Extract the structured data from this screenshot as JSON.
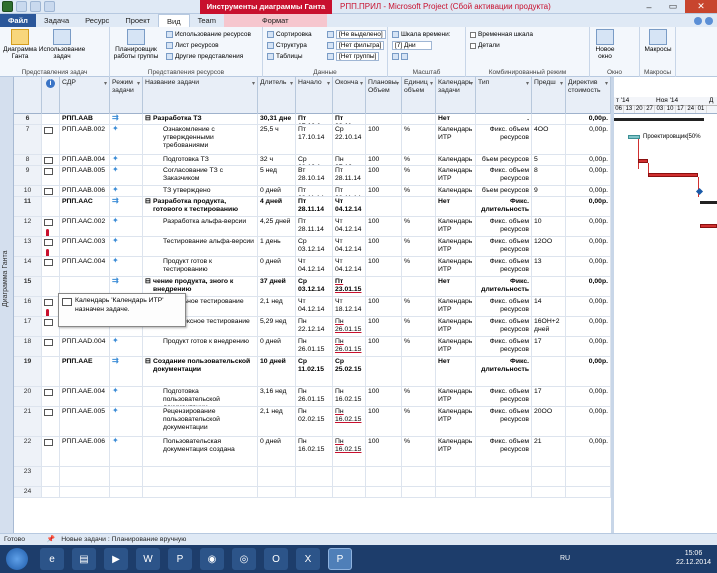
{
  "titlebar": {
    "tools": "Инструменты диаграммы Ганта",
    "file": "РПП.ПРИЛ",
    "sep": "-",
    "app": "Microsoft Project (Сбой активации продукта)"
  },
  "tabs": [
    "Файл",
    "Задача",
    "Ресурс",
    "Проект",
    "Вид",
    "Team",
    "Формат"
  ],
  "ribbon": {
    "gantt_btn": "Диаграмма Ганта",
    "usage_btn": "Использование задач",
    "planner_btn": "Планировщик работы группы",
    "res_usage": "Использование ресурсов",
    "res_sheet": "Лист ресурсов",
    "other_views": "Другие представления",
    "sort": "Сортировка",
    "structure": "Структура",
    "tables": "Таблицы",
    "hl_val": "[Не выделено]",
    "filter_val": "[Нет фильтра]",
    "group_val": "[Нет группы]",
    "timescale": "Шкала времени:",
    "timescale_val": "[7] Дни",
    "timeline_chk": "Временная шкала",
    "details_chk": "Детали",
    "new_window": "Новое окно",
    "macros": "Макросы",
    "g_task_views": "Представления задач",
    "g_res_views": "Представления ресурсов",
    "g_data": "Данные",
    "g_zoom": "Масштаб",
    "g_split": "Комбинированный режим",
    "g_window": "Окно",
    "g_macros": "Макросы"
  },
  "sidebar_label": "Диаграмма Ганта",
  "columns": [
    "СДР",
    "Режим задачи",
    "Название задачи",
    "Длитель",
    "Начало",
    "Оконча",
    "Плановы Объем",
    "Единиц объем",
    "Календарь задачи",
    "Тип",
    "Предш",
    "Директив стоимость"
  ],
  "rows": [
    {
      "n": "6",
      "icons": "",
      "mode": "auto",
      "wbs": "РПП.ААВ",
      "name": "Разработка ТЗ",
      "dur": "30,31 дне",
      "start": "Пт 17.10.1",
      "end": "Пт 28.11.",
      "plan": "",
      "unit": "",
      "cal": "Нет",
      "type": ". длительность",
      "pred": "",
      "cost": "0,00р.",
      "sum": true,
      "indent": 0
    },
    {
      "n": "7",
      "icons": "grid",
      "mode": "pin",
      "wbs": "РПП.ААВ.002",
      "name": "Ознакомление с утвержденными требованиями",
      "dur": "25,5 ч",
      "start": "Пт 17.10.14",
      "end": "Ср 22.10.14",
      "plan": "100",
      "unit": "%",
      "cal": "Календарь ИТР",
      "type": "Фикс. объем ресурсов",
      "pred": "4OO",
      "cost": "0,00р.",
      "sum": false,
      "indent": 1
    },
    {
      "n": "8",
      "icons": "grid",
      "mode": "pin",
      "wbs": "РПП.ААВ.004",
      "name": "Подготовка ТЗ",
      "dur": "32 ч",
      "start": "Ср 22.10.1",
      "end": "Пн 27.10.",
      "plan": "100",
      "unit": "%",
      "cal": "Календарь",
      "type": "бъем ресурсов",
      "pred": "5",
      "cost": "0,00р.",
      "sum": false,
      "indent": 1
    },
    {
      "n": "9",
      "icons": "grid",
      "mode": "pin",
      "wbs": "РПП.ААВ.005",
      "name": "Согласование ТЗ с Заказчиком",
      "dur": "5 нед",
      "start": "Вт 28.10.14",
      "end": "Пт 28.11.14",
      "plan": "100",
      "unit": "%",
      "cal": "Календарь ИТР",
      "type": "Фикс. объем ресурсов",
      "pred": "8",
      "cost": "0,00р.",
      "sum": false,
      "indent": 1
    },
    {
      "n": "10",
      "icons": "grid",
      "mode": "pin",
      "wbs": "РПП.ААВ.006",
      "name": "ТЗ утверждено",
      "dur": "0 дней",
      "start": "Пт 28.11.14",
      "end": "Пт 28.11.14",
      "plan": "100",
      "unit": "%",
      "cal": "Календарь",
      "type": "бъем ресурсов",
      "pred": "9",
      "cost": "0,00р.",
      "sum": false,
      "indent": 1
    },
    {
      "n": "11",
      "icons": "",
      "mode": "auto",
      "wbs": "РПП.ААС",
      "name": "Разработка продукта, готового к тестированию",
      "dur": "4 дней",
      "start": "Пт 28.11.14",
      "end": "Чт 04.12.14",
      "plan": "",
      "unit": "",
      "cal": "Нет",
      "type": "Фикс. длительность",
      "pred": "",
      "cost": "0,00р.",
      "sum": true,
      "indent": 0
    },
    {
      "n": "12",
      "icons": "gridp",
      "mode": "pin",
      "wbs": "РПП.ААС.002",
      "name": "Разработка альфа-версии",
      "dur": "4,25 дней",
      "start": "Пт 28.11.14",
      "end": "Чт 04.12.14",
      "plan": "100",
      "unit": "%",
      "cal": "Календарь ИТР",
      "type": "Фикс. объем ресурсов",
      "pred": "10",
      "cost": "0,00р.",
      "sum": false,
      "indent": 1
    },
    {
      "n": "13",
      "icons": "gridp",
      "mode": "pin",
      "wbs": "РПП.ААС.003",
      "name": "Тестирование альфа-версии",
      "dur": "1 день",
      "start": "Ср 03.12.14",
      "end": "Чт 04.12.14",
      "plan": "100",
      "unit": "%",
      "cal": "Календарь ИТР",
      "type": "Фикс. объем ресурсов",
      "pred": "12OO",
      "cost": "0,00р.",
      "sum": false,
      "indent": 1
    },
    {
      "n": "14",
      "icons": "grid",
      "mode": "pin",
      "wbs": "РПП.ААС.004",
      "name": "Продукт готов к тестированию",
      "dur": "0 дней",
      "start": "Чт 04.12.14",
      "end": "Чт 04.12.14",
      "plan": "100",
      "unit": "%",
      "cal": "Календарь ИТР",
      "type": "Фикс. объем ресурсов",
      "pred": "13",
      "cost": "0,00р.",
      "sum": false,
      "indent": 1
    },
    {
      "n": "15",
      "icons": "",
      "mode": "auto",
      "wbs": "",
      "name": "чение продукта, зного к внедрению",
      "dur": "37 дней",
      "start": "Ср 03.12.14",
      "end": "Пт 23.01.15",
      "plan": "",
      "unit": "",
      "cal": "Нет",
      "type": "Фикс. длительность",
      "pred": "",
      "cost": "0,00р.",
      "sum": true,
      "indent": 0
    },
    {
      "n": "16",
      "icons": "gridp",
      "mode": "pin",
      "wbs": "РПП.AAD.002",
      "name": "Модульное тестирование",
      "dur": "2,1 нед",
      "start": "Чт 04.12.14",
      "end": "Чт 18.12.14",
      "plan": "100",
      "unit": "%",
      "cal": "Календарь ИТР",
      "type": "Фикс. объем ресурсов",
      "pred": "14",
      "cost": "0,00р.",
      "sum": false,
      "indent": 1
    },
    {
      "n": "17",
      "icons": "grid",
      "mode": "pin",
      "wbs": "РПП.AAD.003",
      "name": "Комплексное тестирование",
      "dur": "5,29 нед",
      "start": "Пн 22.12.14",
      "end": "Пн 26.01.15",
      "plan": "100",
      "unit": "%",
      "cal": "Календарь ИТР",
      "type": "Фикс. объем ресурсов",
      "pred": "16OH+2 дней",
      "cost": "0,00р.",
      "sum": false,
      "indent": 1
    },
    {
      "n": "18",
      "icons": "grid",
      "mode": "pin",
      "wbs": "РПП.AAD.004",
      "name": "Продукт готов к внедрению",
      "dur": "0 дней",
      "start": "Пн 26.01.15",
      "end": "Пн 26.01.15",
      "plan": "100",
      "unit": "%",
      "cal": "Календарь ИТР",
      "type": "Фикс. объем ресурсов",
      "pred": "17",
      "cost": "0,00р.",
      "sum": false,
      "indent": 1
    },
    {
      "n": "19",
      "icons": "",
      "mode": "auto",
      "wbs": "РПП.ААЕ",
      "name": "Создание пользовательской документации",
      "dur": "10 дней",
      "start": "Ср 11.02.15",
      "end": "Ср 25.02.15",
      "plan": "",
      "unit": "",
      "cal": "Нет",
      "type": "Фикс. длительность",
      "pred": "",
      "cost": "0,00р.",
      "sum": true,
      "indent": 0
    },
    {
      "n": "20",
      "icons": "grid",
      "mode": "pin",
      "wbs": "РПП.ААЕ.004",
      "name": "Подготовка пользовательской документации",
      "dur": "3,16 нед",
      "start": "Пн 26.01.15",
      "end": "Пн 16.02.15",
      "plan": "100",
      "unit": "%",
      "cal": "Календарь ИТР",
      "type": "Фикс. объем ресурсов",
      "pred": "17",
      "cost": "0,00р.",
      "sum": false,
      "indent": 1
    },
    {
      "n": "21",
      "icons": "grid",
      "mode": "pin",
      "wbs": "РПП.ААЕ.005",
      "name": "Рецензирование пользовательской документации",
      "dur": "2,1 нед",
      "start": "Пн 02.02.15",
      "end": "Пн 16.02.15",
      "plan": "100",
      "unit": "%",
      "cal": "Календарь ИТР",
      "type": "Фикс. объем ресурсов",
      "pred": "20OO",
      "cost": "0,00р.",
      "sum": false,
      "indent": 1
    },
    {
      "n": "22",
      "icons": "grid",
      "mode": "pin",
      "wbs": "РПП.ААЕ.006",
      "name": "Пользовательская документация создана",
      "dur": "0 дней",
      "start": "Пн 16.02.15",
      "end": "Пн 16.02.15",
      "plan": "100",
      "unit": "%",
      "cal": "Календарь ИТР",
      "type": "Фикс. объем ресурсов",
      "pred": "21",
      "cost": "0,00р.",
      "sum": false,
      "indent": 1
    },
    {
      "n": "23",
      "icons": "",
      "mode": "",
      "wbs": "",
      "name": "",
      "dur": "",
      "start": "",
      "end": "",
      "plan": "",
      "unit": "",
      "cal": "",
      "type": "",
      "pred": "",
      "cost": "",
      "sum": false,
      "indent": 0
    },
    {
      "n": "24",
      "icons": "",
      "mode": "",
      "wbs": "",
      "name": "",
      "dur": "",
      "start": "",
      "end": "",
      "plan": "",
      "unit": "",
      "cal": "",
      "type": "",
      "pred": "",
      "cost": "",
      "sum": false,
      "indent": 0
    }
  ],
  "tooltip": {
    "line1": "Календарь 'Календарь ИТР'",
    "line2": "назначен задаче."
  },
  "gantt": {
    "month1": "т '14",
    "month2": "Ноя '14",
    "month3": "Д",
    "days": [
      "06",
      "13",
      "20",
      "27",
      "03",
      "10",
      "17",
      "24",
      "01"
    ],
    "bar_label": "Проектировщик[50%"
  },
  "status": {
    "ready": "Готово",
    "mode": "Новые задачи : Планирование вручную"
  },
  "taskbar": {
    "lang": "RU",
    "time": "15:06",
    "date": "22.12.2014"
  }
}
